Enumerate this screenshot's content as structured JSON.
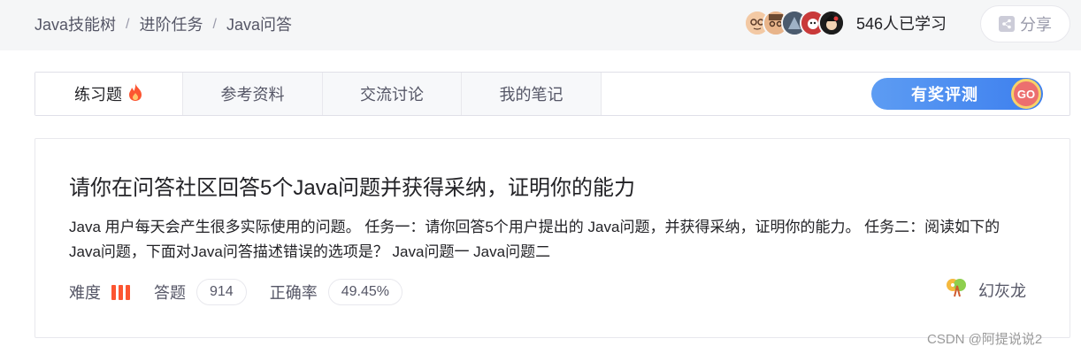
{
  "breadcrumb": {
    "items": [
      "Java技能树",
      "进阶任务",
      "Java问答"
    ],
    "separator": "/"
  },
  "header": {
    "avatars": [
      "avatar-1",
      "avatar-2",
      "avatar-3",
      "avatar-4",
      "avatar-5"
    ],
    "learn_count": "546人已学习",
    "share_label": "分享"
  },
  "tabs": [
    {
      "label": "练习题",
      "icon": "fire-icon",
      "active": true
    },
    {
      "label": "参考资料"
    },
    {
      "label": "交流讨论"
    },
    {
      "label": "我的笔记"
    }
  ],
  "eval_button": {
    "label": "有奖评测",
    "badge": "GO"
  },
  "card": {
    "title": "请你在问答社区回答5个Java问题并获得采纳，证明你的能力",
    "description": "Java 用户每天会产生很多实际使用的问题。 任务一：请你回答5个用户提出的 Java问题，并获得采纳，证明你的能力。 任务二：阅读如下的Java问题，下面对Java问答描述错误的选项是？ Java问题一 Java问题二",
    "difficulty_label": "难度",
    "difficulty_level": 3,
    "answers_label": "答题",
    "answers_count": "914",
    "accuracy_label": "正确率",
    "accuracy_value": "49.45%",
    "author": "幻灰龙"
  },
  "watermark": "CSDN @阿提说说2",
  "colors": {
    "accent": "#fc5531",
    "eval_blue": "#3d7fee",
    "go_red": "#ec6f6f",
    "header_bg": "#f5f6f7"
  }
}
